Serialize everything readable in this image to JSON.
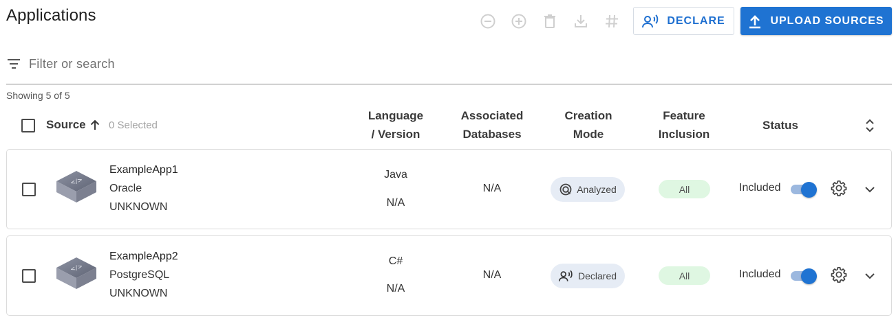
{
  "page": {
    "title": "Applications"
  },
  "toolbar": {
    "icons": [
      "remove-circle-icon",
      "add-circle-icon",
      "delete-icon",
      "download-icon",
      "tag-icon"
    ],
    "declare_label": "DECLARE",
    "upload_label": "UPLOAD SOURCES"
  },
  "filter": {
    "placeholder": "Filter or search"
  },
  "summary": {
    "showing": "Showing 5 of 5"
  },
  "table": {
    "headers": {
      "source": "Source",
      "selected": "0 Selected",
      "language_1": "Language",
      "language_2": "/ Version",
      "databases_1": "Associated",
      "databases_2": "Databases",
      "creation_1": "Creation",
      "creation_2": "Mode",
      "feature_1": "Feature",
      "feature_2": "Inclusion",
      "status": "Status"
    },
    "rows": [
      {
        "name": "ExampleApp1",
        "database": "Oracle",
        "app_status": "UNKNOWN",
        "language": "Java",
        "version": "N/A",
        "associated_databases": "N/A",
        "creation_mode": "Analyzed",
        "creation_icon": "analyzed-icon",
        "feature_inclusion": "All",
        "status": "Included",
        "status_toggle_on": true
      },
      {
        "name": "ExampleApp2",
        "database": "PostgreSQL",
        "app_status": "UNKNOWN",
        "language": "C#",
        "version": "N/A",
        "associated_databases": "N/A",
        "creation_mode": "Declared",
        "creation_icon": "declared-icon",
        "feature_inclusion": "All",
        "status": "Included",
        "status_toggle_on": true
      }
    ]
  },
  "colors": {
    "primary": "#1f73d2",
    "pill_mode_bg": "#e6ecf5",
    "pill_all_bg": "#dff7e2",
    "toggle_track": "#9cb8df"
  }
}
